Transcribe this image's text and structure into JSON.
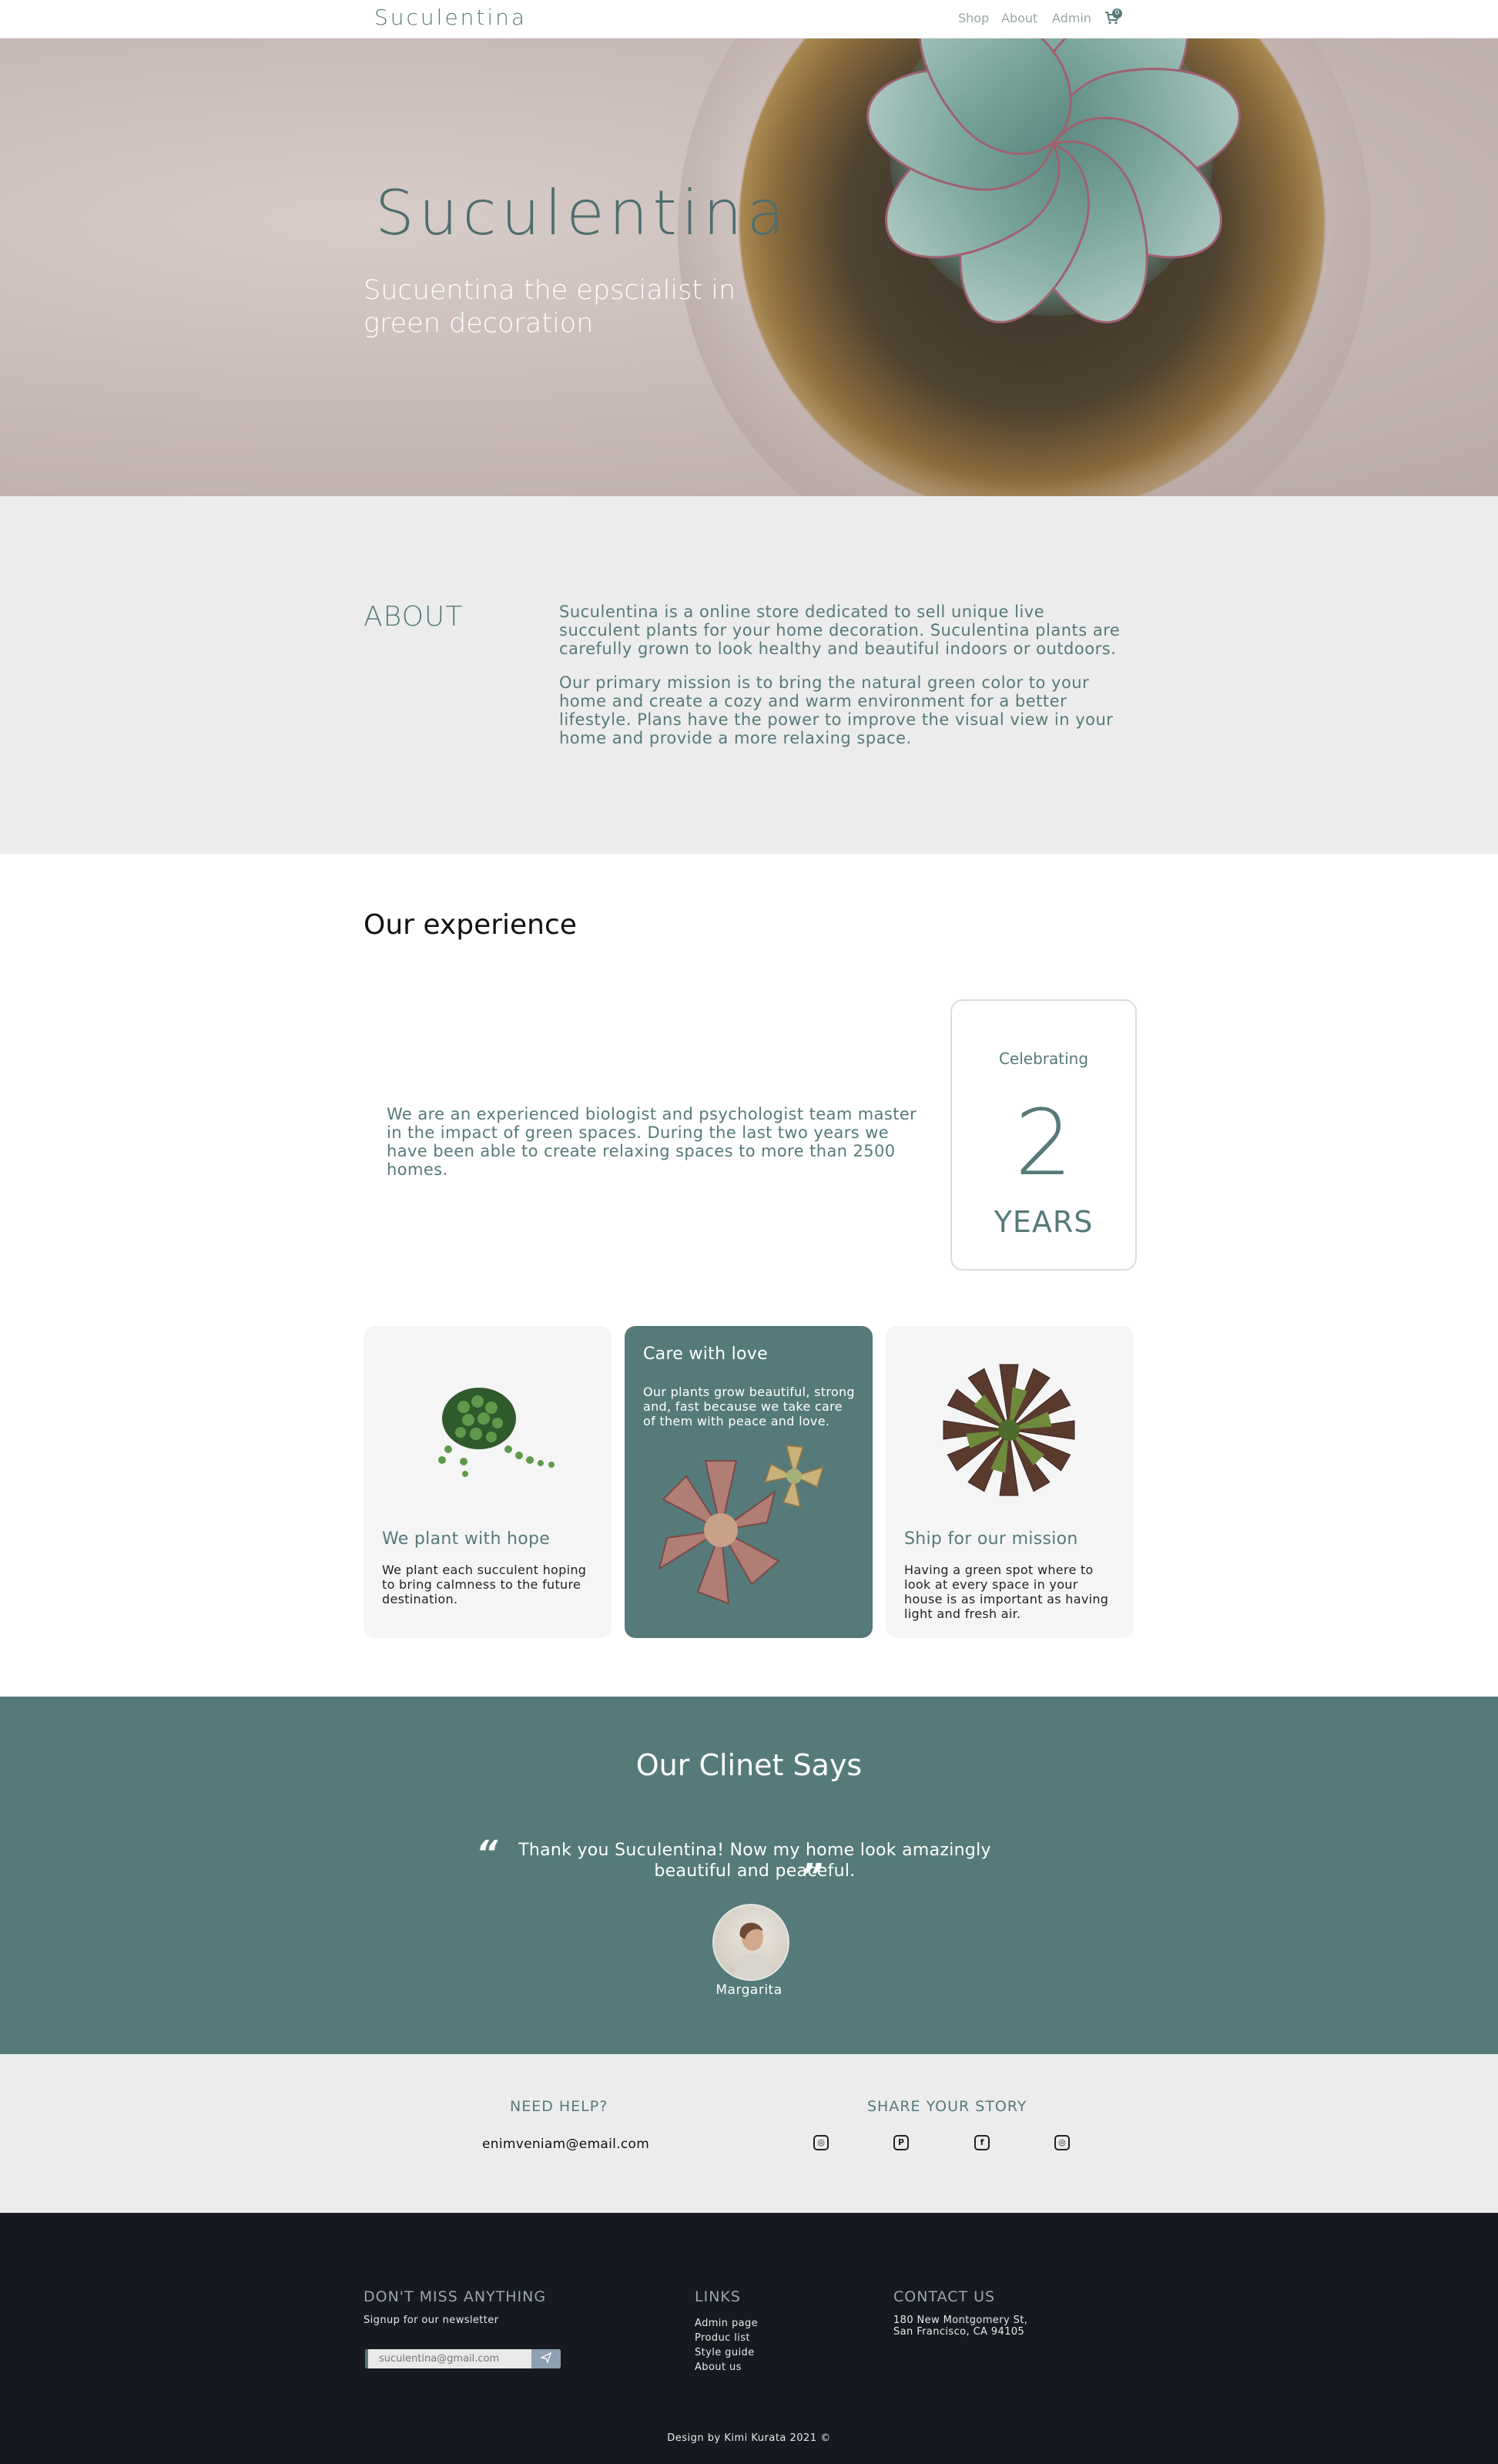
{
  "nav": {
    "logo": "Suculentina",
    "links": [
      "Shop",
      "About",
      "Admin"
    ],
    "cart_count": "0",
    "cart_icon": "cart-icon"
  },
  "hero": {
    "brand": "Suculentina",
    "tagline": "Sucuentina the epscialist in green decoration"
  },
  "about": {
    "heading": "ABOUT",
    "paragraphs": [
      "Suculentina is a online store dedicated to sell unique live succulent plants for your home decoration. Suculentina plants are carefully grown to look healthy and beautiful indoors or outdoors.",
      "Our primary mission is to bring the natural green color to your home and create a cozy and warm environment for a better lifestyle. Plans have the power to improve the visual view in your home and provide a more relaxing space."
    ]
  },
  "experience": {
    "title": "Our experience",
    "text": "We are an experienced biologist and psychologist team master in the impact of green spaces. During the last two years we have been able to create relaxing spaces to more than 2500 homes.",
    "celebrating": {
      "label": "Celebrating",
      "number": "2",
      "unit": "YEARS"
    },
    "cards": [
      {
        "title": "We plant with hope",
        "text": "We plant each succulent hoping to bring calmness to the future destination."
      },
      {
        "title": "Care with love",
        "text": "Our plants grow beautiful, strong and, fast because we take care of them with peace and love."
      },
      {
        "title": "Ship for our mission",
        "text": "Having a green spot where to look at every space in your house is as important as having light and fresh air."
      }
    ]
  },
  "testimonial": {
    "title": "Our Clinet Says",
    "quote": "Thank you Suculentina! Now my home look amazingly beautiful and peaceful.",
    "name": "Margarita"
  },
  "help": {
    "need_help": "NEED HELP?",
    "email": "enimveniam@email.com",
    "share": "SHARE YOUR STORY",
    "social_icons": [
      "instagram-icon",
      "pinterest-icon",
      "facebook-icon",
      "instagram-alt-icon"
    ]
  },
  "footer": {
    "newsletter_heading": "DON'T MISS ANYTHING",
    "newsletter_sub": "Signup for our newsletter",
    "newsletter_placeholder": "suculentina@gmail.com",
    "links_heading": "LINKS",
    "links": [
      "Admin page",
      "Produc list",
      "Style guide",
      "About us"
    ],
    "contact_heading": "CONTACT US",
    "address_line1": "180 New Montgomery St,",
    "address_line2": "San Francisco, CA 94105",
    "credit": "Design by Kimi Kurata 2021 ©"
  },
  "colors": {
    "accent": "#557a79",
    "footer_bg": "#161a20",
    "section_bg": "#ececec"
  }
}
